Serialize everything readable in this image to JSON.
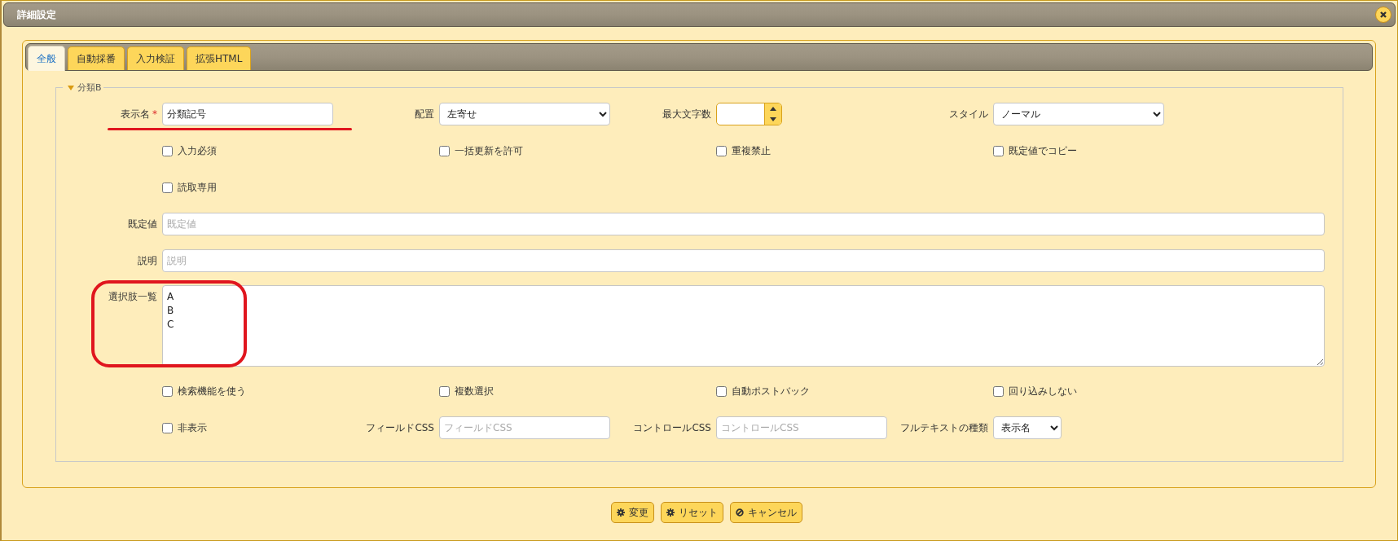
{
  "window": {
    "title": "詳細設定"
  },
  "tabs": [
    {
      "label": "全般",
      "selected": true
    },
    {
      "label": "自動採番",
      "selected": false
    },
    {
      "label": "入力検証",
      "selected": false
    },
    {
      "label": "拡張HTML",
      "selected": false
    }
  ],
  "section": {
    "legend": "分類B",
    "expanded": true,
    "rows": [
      {
        "kind": "fields",
        "items": [
          {
            "kind": "text",
            "label": "表示名",
            "required_mark": "*",
            "value": "分類記号"
          },
          {
            "kind": "select",
            "label": "配置",
            "value": "左寄せ"
          },
          {
            "kind": "spinner",
            "label": "最大文字数"
          },
          {
            "kind": "select",
            "label": "スタイル",
            "value": "ノーマル"
          }
        ]
      },
      {
        "kind": "checks",
        "items": [
          {
            "label": "入力必須",
            "checked": false
          },
          {
            "label": "一括更新を許可",
            "checked": false
          },
          {
            "label": "重複禁止",
            "checked": false
          },
          {
            "label": "既定値でコピー",
            "checked": false
          }
        ]
      },
      {
        "kind": "checks",
        "items": [
          {
            "label": "読取専用",
            "checked": false
          }
        ]
      },
      {
        "kind": "wide",
        "label": "既定値",
        "placeholder": "既定値"
      },
      {
        "kind": "wide",
        "label": "説明",
        "placeholder": "説明"
      },
      {
        "kind": "textarea",
        "label": "選択肢一覧",
        "value": "A\nB\nC"
      },
      {
        "kind": "checks",
        "items": [
          {
            "label": "検索機能を使う",
            "checked": false
          },
          {
            "label": "複数選択",
            "checked": false
          },
          {
            "label": "自動ポストバック",
            "checked": false
          },
          {
            "label": "回り込みしない",
            "checked": false
          }
        ]
      },
      {
        "kind": "mixed",
        "items": [
          {
            "kind": "checkbox",
            "label": "非表示",
            "checked": false
          },
          {
            "kind": "text",
            "label": "フィールドCSS",
            "placeholder": "フィールドCSS"
          },
          {
            "kind": "text",
            "label": "コントロールCSS",
            "placeholder": "コントロールCSS"
          },
          {
            "kind": "short-select",
            "label": "フルテキストの種類",
            "value": "表示名"
          }
        ]
      }
    ]
  },
  "buttons": [
    {
      "kind": "apply",
      "label": "変更"
    },
    {
      "kind": "reset",
      "label": "リセット"
    },
    {
      "kind": "cancel",
      "label": "キャンセル"
    }
  ]
}
